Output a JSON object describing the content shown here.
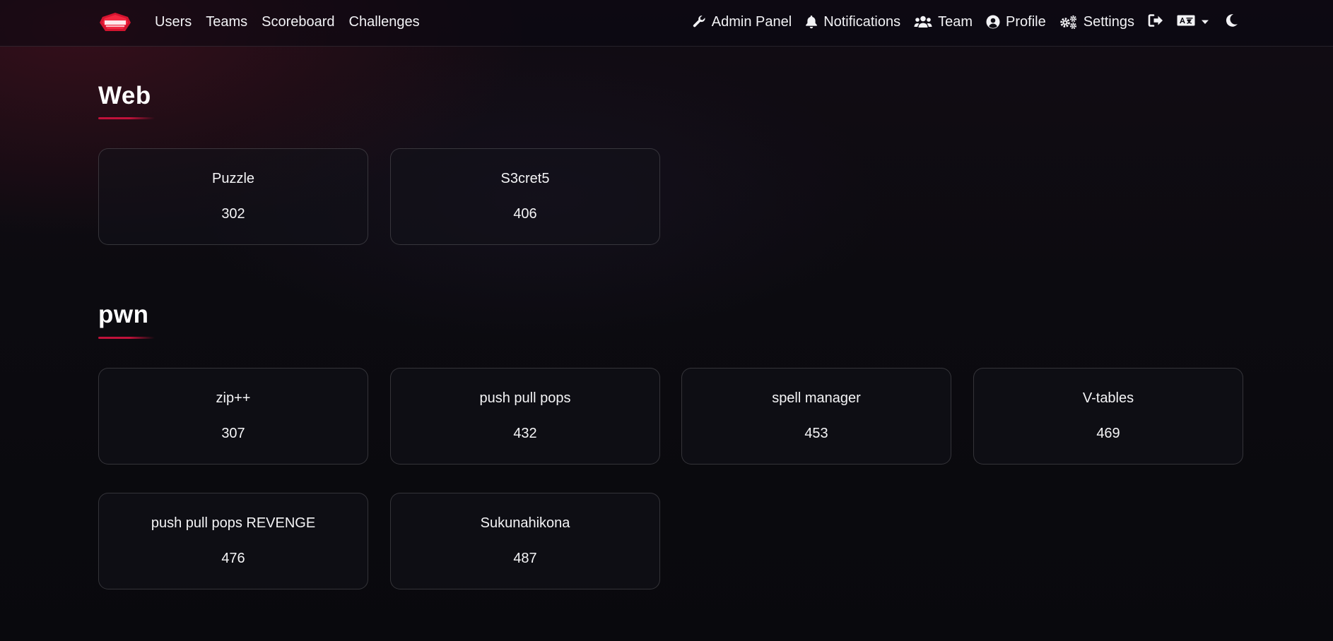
{
  "nav": {
    "brand_icon": "ctf-logo",
    "left": [
      {
        "label": "Users"
      },
      {
        "label": "Teams"
      },
      {
        "label": "Scoreboard"
      },
      {
        "label": "Challenges"
      }
    ],
    "right": [
      {
        "label": "Admin Panel",
        "icon": "wrench-icon"
      },
      {
        "label": "Notifications",
        "icon": "bell-icon"
      },
      {
        "label": "Team",
        "icon": "users-icon"
      },
      {
        "label": "Profile",
        "icon": "user-circle-icon"
      },
      {
        "label": "Settings",
        "icon": "cogs-icon"
      }
    ],
    "logout_icon": "logout-icon",
    "language_icon": "language-icon",
    "theme_icon": "moon-icon"
  },
  "colors": {
    "accent": "#c0123a",
    "text": "#ffffff"
  },
  "categories": [
    {
      "title": "Web",
      "challenges": [
        {
          "name": "Puzzle",
          "value": "302"
        },
        {
          "name": "S3cret5",
          "value": "406"
        }
      ]
    },
    {
      "title": "pwn",
      "challenges": [
        {
          "name": "zip++",
          "value": "307"
        },
        {
          "name": "push pull pops",
          "value": "432"
        },
        {
          "name": "spell manager",
          "value": "453"
        },
        {
          "name": "V-tables",
          "value": "469"
        },
        {
          "name": "push pull pops REVENGE",
          "value": "476"
        },
        {
          "name": "Sukunahikona",
          "value": "487"
        }
      ]
    }
  ]
}
